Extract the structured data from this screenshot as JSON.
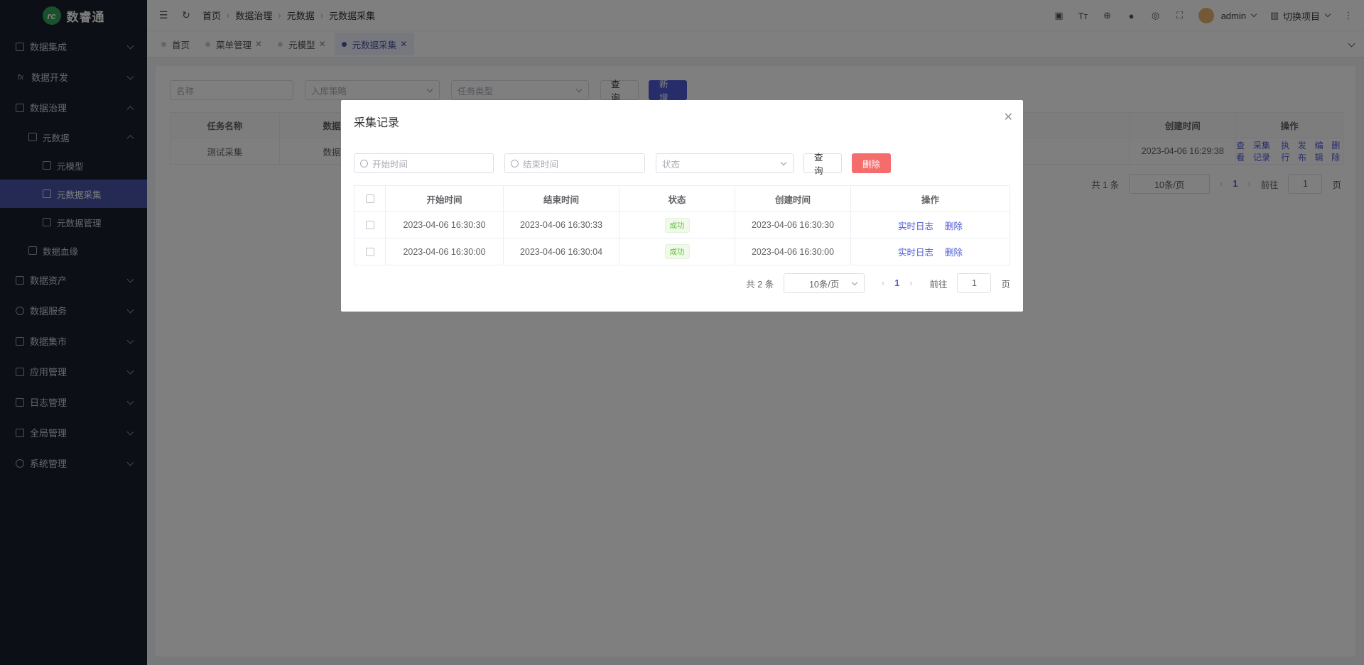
{
  "app": {
    "title": "数睿通"
  },
  "sidebar": {
    "items": [
      {
        "label": "数据集成",
        "icon": "grid-icon"
      },
      {
        "label": "数据开发",
        "icon": "fx-icon"
      },
      {
        "label": "数据治理",
        "icon": "table-icon"
      },
      {
        "label": "元数据",
        "icon": "doc-icon"
      },
      {
        "label": "元模型",
        "icon": "file-icon"
      },
      {
        "label": "元数据采集",
        "icon": "collect-icon"
      },
      {
        "label": "元数据管理",
        "icon": "manage-icon"
      },
      {
        "label": "数据血缘",
        "icon": "lineage-icon"
      },
      {
        "label": "数据资产",
        "icon": "asset-icon"
      },
      {
        "label": "数据服务",
        "icon": "service-icon"
      },
      {
        "label": "数据集市",
        "icon": "market-icon"
      },
      {
        "label": "应用管理",
        "icon": "app-icon"
      },
      {
        "label": "日志管理",
        "icon": "log-icon"
      },
      {
        "label": "全局管理",
        "icon": "global-icon"
      },
      {
        "label": "系统管理",
        "icon": "settings-icon"
      }
    ]
  },
  "header": {
    "breadcrumb": [
      "首页",
      "数据治理",
      "元数据",
      "元数据采集"
    ],
    "user": "admin",
    "project": "切换项目"
  },
  "tabs": [
    {
      "label": "首页"
    },
    {
      "label": "菜单管理"
    },
    {
      "label": "元模型"
    },
    {
      "label": "元数据采集"
    }
  ],
  "filters": {
    "name_placeholder": "名称",
    "strategy_placeholder": "入库策略",
    "type_placeholder": "任务类型",
    "query": "查询",
    "add": "新增"
  },
  "bg_table": {
    "headers": {
      "name": "任务名称",
      "db": "数据库",
      "created": "创建时间",
      "ops": "操作"
    },
    "row": {
      "name": "测试采集",
      "db": "数据库",
      "created": "2023-04-06 16:29:38"
    },
    "ops": [
      "查看",
      "采集记录",
      "执行",
      "发布",
      "编辑",
      "删除"
    ],
    "pager": {
      "total": "共 1 条",
      "size": "10条/页",
      "page": "1",
      "goto": "前往",
      "goto_value": "1",
      "unit": "页"
    }
  },
  "dialog": {
    "title": "采集记录",
    "start_placeholder": "开始时间",
    "end_placeholder": "结束时间",
    "status_placeholder": "状态",
    "query": "查询",
    "delete": "删除",
    "headers": {
      "start": "开始时间",
      "end": "结束时间",
      "status": "状态",
      "created": "创建时间",
      "ops": "操作"
    },
    "rows": [
      {
        "start": "2023-04-06 16:30:30",
        "end": "2023-04-06 16:30:33",
        "status": "成功",
        "created": "2023-04-06 16:30:30",
        "log": "实时日志",
        "del": "删除"
      },
      {
        "start": "2023-04-06 16:30:00",
        "end": "2023-04-06 16:30:04",
        "status": "成功",
        "created": "2023-04-06 16:30:00",
        "log": "实时日志",
        "del": "删除"
      }
    ],
    "pager": {
      "total": "共 2 条",
      "size": "10条/页",
      "page": "1",
      "goto": "前往",
      "goto_value": "1",
      "unit": "页"
    }
  },
  "colors": {
    "accent": "#4f5bd5",
    "sidebar": "#191f2b",
    "danger": "#f56c6c",
    "success": "#67c23a"
  }
}
